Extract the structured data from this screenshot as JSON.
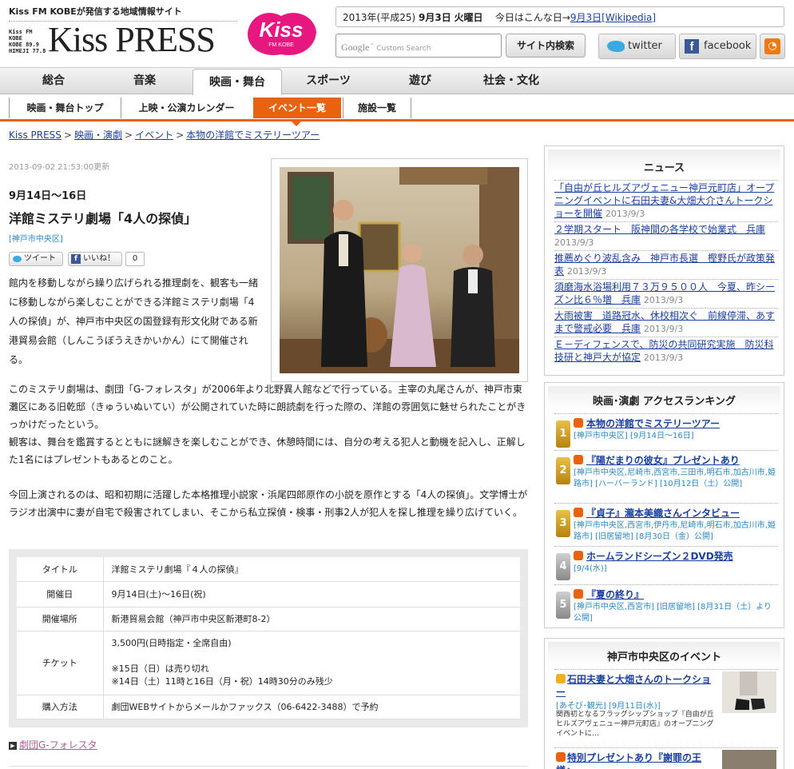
{
  "header": {
    "tagline": "Kiss FM KOBEが発信する地域情報サイト",
    "logo_sub": [
      "Kiss FM KOBE",
      "KOBE 89.9",
      "HIMEJI 77.8"
    ],
    "logo_main": "Kiss PRESS",
    "kiss_logo_text": "Kiss",
    "kiss_logo_sub": "FM KOBE",
    "date_prefix": "2013年(平成25)",
    "date_day": "9月3日",
    "date_weekday": "火曜日",
    "today_label": "今日はこんな日→",
    "today_link": "9月3日[Wikipedia]",
    "search_brand": "Google",
    "search_placeholder": "Custom Search",
    "search_button": "サイト内検索",
    "twitter_label": "twitter",
    "facebook_label": "facebook"
  },
  "main_nav": [
    "総合",
    "音楽",
    "映画・舞台",
    "スポーツ",
    "遊び",
    "社会・文化"
  ],
  "main_nav_active": "映画・舞台",
  "sub_nav": [
    "映画・舞台トップ",
    "上映・公演カレンダー",
    "イベント一覧",
    "施設一覧"
  ],
  "sub_nav_active": "イベント一覧",
  "breadcrumb": [
    "Kiss PRESS",
    "映画・演劇",
    "イベント",
    "本物の洋館でミステリーツアー"
  ],
  "article": {
    "timestamp": "2013-09-02 21:53:00更新",
    "date_range": "9月14日〜16日",
    "title": "洋館ミステリ劇場「4人の探偵」",
    "area": "[神戸市中央区]",
    "tweet_label": "ツイート",
    "like_label": "いいね！",
    "like_count": "0",
    "lead": "館内を移動しながら繰り広げられる推理劇を、観客も一緒に移動しながら楽しむことができる洋館ミステリ劇場「4人の探偵」が、神戸市中央区の国登録有形文化財である新港貿易会館（しんこうぼうえきかいかん）にて開催される。",
    "paragraphs": [
      "このミステリ劇場は、劇団「G-フォレスタ」が2006年より北野異人館などで行っている。主宰の丸尾さんが、神戸市東灘区にある旧乾邸（きゅういぬいてい）が公開されていた時に朗読劇を行った際の、洋館の雰囲気に魅せられたことがきっかけだったという。\n観客は、舞台を鑑賞するとともに謎解きを楽しむことができ、休憩時間には、自分の考える犯人と動機を記入し、正解した1名にはプレゼントもあるとのこと。",
      "今回上演されるのは、昭和初期に活躍した本格推理小説家・浜尾四郎原作の小説を原作とする「4人の探偵」。文学博士がラジオ出演中に妻が自宅で殺害されてしまい、そこから私立探偵・検事・刑事2人が犯人を探し推理を繰り広げていく。"
    ],
    "info": [
      {
        "key": "タイトル",
        "value": "洋館ミステリ劇場『４人の探偵』"
      },
      {
        "key": "開催日",
        "value": "9月14日(土)〜16日(祝)"
      },
      {
        "key": "開催場所",
        "value": "新港貿易会館（神戸市中央区新港町8-2）"
      },
      {
        "key": "チケット",
        "value": "3,500円(日時指定・全席自由)\n\n※15日（日）は売り切れ\n※14日（土）11時と16日（月・祝）14時30分のみ残少"
      },
      {
        "key": "購入方法",
        "value": "劇団WEBサイトからメールかファックス（06-6422-3488）で予約"
      }
    ],
    "external_link": "劇団G-フォレスタ"
  },
  "news": {
    "title": "ニュース",
    "items": [
      {
        "text": "「自由が丘ヒルズアヴェニュー神戸元町店」オープニングイベントに石田夫妻&大畑大介さんトークショーを開催",
        "date": "2013/9/3"
      },
      {
        "text": "２学期スタート　阪神間の各学校で始業式　兵庫",
        "date": "2013/9/3"
      },
      {
        "text": "推薦めぐり波乱含み　神戸市長選　樫野氏が政策発表",
        "date": "2013/9/3"
      },
      {
        "text": "須磨海水浴場利用７３万９５００人　今夏、昨シーズン比６％増　兵庫",
        "date": "2013/9/3"
      },
      {
        "text": "大雨被害　道路冠水、休校相次ぐ　前線停滞、あすまで警戒必要　兵庫",
        "date": "2013/9/3"
      },
      {
        "text": "Ｅ－ディフェンスで、防災の共同研究実施　防災科技研と神戸大が協定",
        "date": "2013/9/3"
      }
    ]
  },
  "ranking": {
    "title": "映画･演劇 アクセスランキング",
    "items": [
      {
        "rank": "1",
        "title": "本物の洋館でミステリーツアー",
        "meta": "[神戸市中央区] [9月14日〜16日]"
      },
      {
        "rank": "2",
        "title": "『陽だまりの彼女』プレゼントあり",
        "meta": "[神戸市中央区,尼崎市,西宮市,三田市,明石市,加古川市,姫路市] [ハーバーランド] [10月12日（土）公開]"
      },
      {
        "rank": "3",
        "title": "『貞子』瀧本美織さんインタビュー",
        "meta": "[神戸市中央区,西宮市,伊丹市,尼崎市,明石市,加古川市,姫路市] [旧居留地] [8月30日（金）公開]"
      },
      {
        "rank": "4",
        "title": "ホームランドシーズン２DVD発売",
        "meta": "[9/4(水)]"
      },
      {
        "rank": "5",
        "title": "『夏の終り』",
        "meta": "[神戸市中央区,西宮市] [旧居留地] [8月31日（土）より公開]"
      }
    ]
  },
  "events": {
    "title": "神戸市中央区のイベント",
    "items": [
      {
        "title": "石田夫妻と大畑さんのトークショー",
        "meta": "[あそび･観光] [9月11日(水)]",
        "desc": "関西初となるフラッグシップショップ『自由が丘ヒルズアヴェニュー神戸元町店』のオープニングイベントに…"
      },
      {
        "title": "特別プレゼントあり『謝罪の王様』",
        "meta": "",
        "desc": ""
      }
    ]
  },
  "colors": {
    "accent": "#e8620f",
    "link": "#1a3f9e",
    "area": "#2a87c4"
  }
}
